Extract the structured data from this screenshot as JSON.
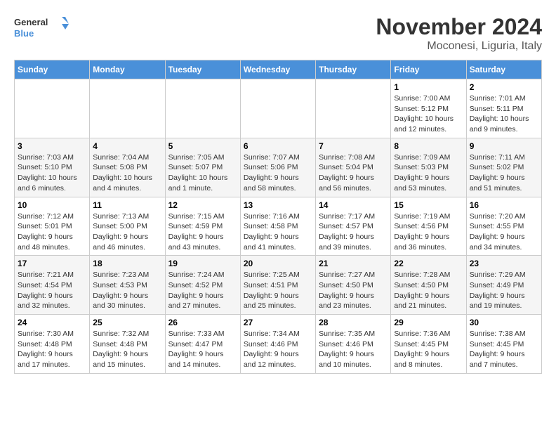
{
  "header": {
    "logo": {
      "line1": "General",
      "line2": "Blue"
    },
    "title": "November 2024",
    "subtitle": "Moconesi, Liguria, Italy"
  },
  "calendar": {
    "days_of_week": [
      "Sunday",
      "Monday",
      "Tuesday",
      "Wednesday",
      "Thursday",
      "Friday",
      "Saturday"
    ],
    "weeks": [
      [
        {
          "day": "",
          "info": ""
        },
        {
          "day": "",
          "info": ""
        },
        {
          "day": "",
          "info": ""
        },
        {
          "day": "",
          "info": ""
        },
        {
          "day": "",
          "info": ""
        },
        {
          "day": "1",
          "info": "Sunrise: 7:00 AM\nSunset: 5:12 PM\nDaylight: 10 hours and 12 minutes."
        },
        {
          "day": "2",
          "info": "Sunrise: 7:01 AM\nSunset: 5:11 PM\nDaylight: 10 hours and 9 minutes."
        }
      ],
      [
        {
          "day": "3",
          "info": "Sunrise: 7:03 AM\nSunset: 5:10 PM\nDaylight: 10 hours and 6 minutes."
        },
        {
          "day": "4",
          "info": "Sunrise: 7:04 AM\nSunset: 5:08 PM\nDaylight: 10 hours and 4 minutes."
        },
        {
          "day": "5",
          "info": "Sunrise: 7:05 AM\nSunset: 5:07 PM\nDaylight: 10 hours and 1 minute."
        },
        {
          "day": "6",
          "info": "Sunrise: 7:07 AM\nSunset: 5:06 PM\nDaylight: 9 hours and 58 minutes."
        },
        {
          "day": "7",
          "info": "Sunrise: 7:08 AM\nSunset: 5:04 PM\nDaylight: 9 hours and 56 minutes."
        },
        {
          "day": "8",
          "info": "Sunrise: 7:09 AM\nSunset: 5:03 PM\nDaylight: 9 hours and 53 minutes."
        },
        {
          "day": "9",
          "info": "Sunrise: 7:11 AM\nSunset: 5:02 PM\nDaylight: 9 hours and 51 minutes."
        }
      ],
      [
        {
          "day": "10",
          "info": "Sunrise: 7:12 AM\nSunset: 5:01 PM\nDaylight: 9 hours and 48 minutes."
        },
        {
          "day": "11",
          "info": "Sunrise: 7:13 AM\nSunset: 5:00 PM\nDaylight: 9 hours and 46 minutes."
        },
        {
          "day": "12",
          "info": "Sunrise: 7:15 AM\nSunset: 4:59 PM\nDaylight: 9 hours and 43 minutes."
        },
        {
          "day": "13",
          "info": "Sunrise: 7:16 AM\nSunset: 4:58 PM\nDaylight: 9 hours and 41 minutes."
        },
        {
          "day": "14",
          "info": "Sunrise: 7:17 AM\nSunset: 4:57 PM\nDaylight: 9 hours and 39 minutes."
        },
        {
          "day": "15",
          "info": "Sunrise: 7:19 AM\nSunset: 4:56 PM\nDaylight: 9 hours and 36 minutes."
        },
        {
          "day": "16",
          "info": "Sunrise: 7:20 AM\nSunset: 4:55 PM\nDaylight: 9 hours and 34 minutes."
        }
      ],
      [
        {
          "day": "17",
          "info": "Sunrise: 7:21 AM\nSunset: 4:54 PM\nDaylight: 9 hours and 32 minutes."
        },
        {
          "day": "18",
          "info": "Sunrise: 7:23 AM\nSunset: 4:53 PM\nDaylight: 9 hours and 30 minutes."
        },
        {
          "day": "19",
          "info": "Sunrise: 7:24 AM\nSunset: 4:52 PM\nDaylight: 9 hours and 27 minutes."
        },
        {
          "day": "20",
          "info": "Sunrise: 7:25 AM\nSunset: 4:51 PM\nDaylight: 9 hours and 25 minutes."
        },
        {
          "day": "21",
          "info": "Sunrise: 7:27 AM\nSunset: 4:50 PM\nDaylight: 9 hours and 23 minutes."
        },
        {
          "day": "22",
          "info": "Sunrise: 7:28 AM\nSunset: 4:50 PM\nDaylight: 9 hours and 21 minutes."
        },
        {
          "day": "23",
          "info": "Sunrise: 7:29 AM\nSunset: 4:49 PM\nDaylight: 9 hours and 19 minutes."
        }
      ],
      [
        {
          "day": "24",
          "info": "Sunrise: 7:30 AM\nSunset: 4:48 PM\nDaylight: 9 hours and 17 minutes."
        },
        {
          "day": "25",
          "info": "Sunrise: 7:32 AM\nSunset: 4:48 PM\nDaylight: 9 hours and 15 minutes."
        },
        {
          "day": "26",
          "info": "Sunrise: 7:33 AM\nSunset: 4:47 PM\nDaylight: 9 hours and 14 minutes."
        },
        {
          "day": "27",
          "info": "Sunrise: 7:34 AM\nSunset: 4:46 PM\nDaylight: 9 hours and 12 minutes."
        },
        {
          "day": "28",
          "info": "Sunrise: 7:35 AM\nSunset: 4:46 PM\nDaylight: 9 hours and 10 minutes."
        },
        {
          "day": "29",
          "info": "Sunrise: 7:36 AM\nSunset: 4:45 PM\nDaylight: 9 hours and 8 minutes."
        },
        {
          "day": "30",
          "info": "Sunrise: 7:38 AM\nSunset: 4:45 PM\nDaylight: 9 hours and 7 minutes."
        }
      ]
    ]
  }
}
